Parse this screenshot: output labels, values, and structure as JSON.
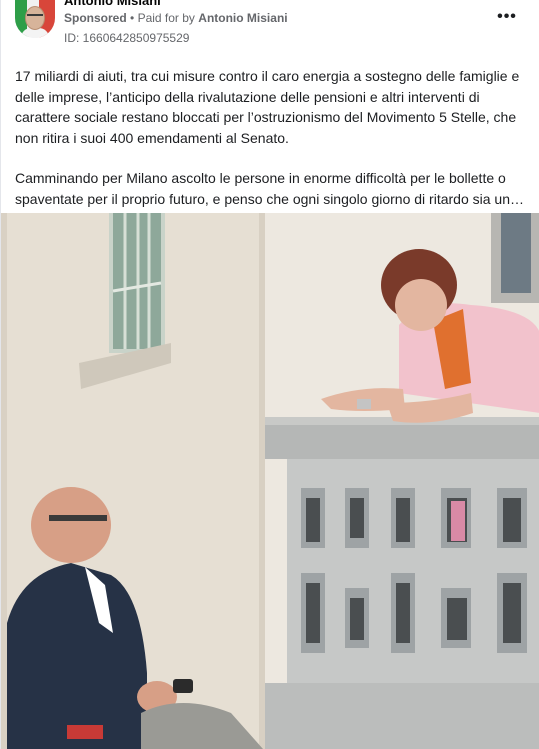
{
  "post": {
    "author": "Antonio Misiani",
    "sponsored_label": "Sponsored",
    "paid_for_prefix": "Paid for by",
    "paid_for_name": "Antonio Misiani",
    "ad_id": "ID: 1660642850975529",
    "more_icon": "more-dots-icon",
    "text_paragraph_1": "17 miliardi di aiuti, tra cui misure contro il caro energia a sostegno delle famiglie e delle imprese, l’anticipo della rivalutazione delle pensioni e altri interventi di carattere sociale restano bloccati per l’ostruzionismo del Movimento 5 Stelle, che non ritira i suoi 400 emendamenti al Senato.",
    "text_paragraph_2": "Camminando per Milano ascolto le persone in enorme difficoltà per le bollette o spaventate per il proprio futuro, e penso che ogni singolo giorno di ritardo sia un…"
  },
  "colors": {
    "text": "#1c1e21",
    "secondary": "#65676b",
    "avatar_green": "#2e9e48",
    "avatar_red": "#d8463a"
  }
}
